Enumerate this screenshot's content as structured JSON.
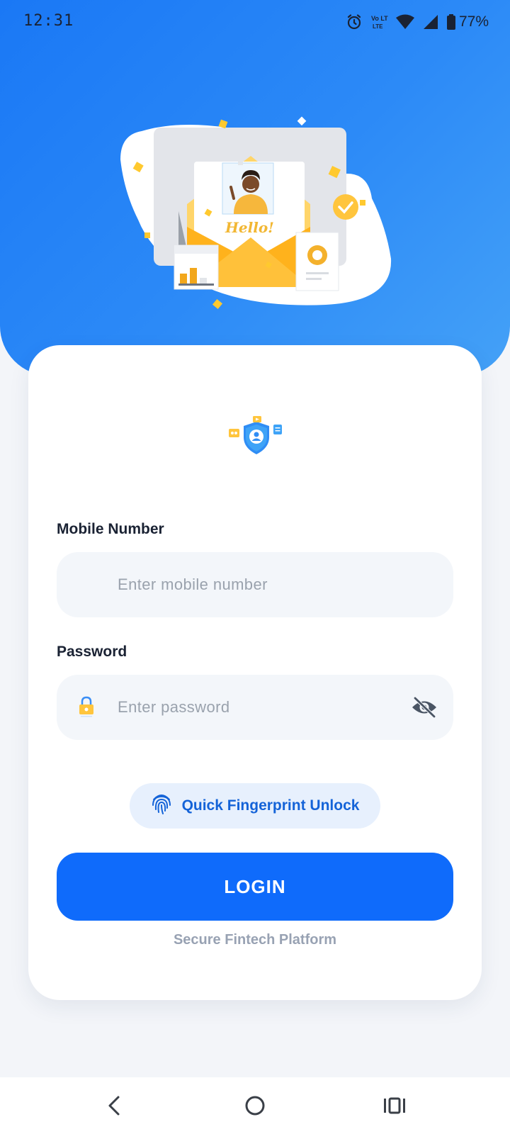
{
  "status_bar": {
    "time": "12:31",
    "volte_label": "Vo LTE",
    "battery": "77%",
    "icons": [
      "alarm-icon",
      "volte-icon",
      "wifi-icon",
      "signal-icon",
      "battery-icon"
    ]
  },
  "hero_illustration": {
    "text": "Hello!"
  },
  "form": {
    "mobile_label": "Mobile Number",
    "mobile_placeholder": "Enter mobile number",
    "password_label": "Password",
    "password_placeholder": "Enter password",
    "fingerprint_label": "Quick Fingerprint Unlock",
    "login_label": "LOGIN",
    "footer": "Secure Fintech Platform"
  },
  "nav_bar": {
    "icons": [
      "back-icon",
      "home-icon",
      "recents-icon"
    ]
  },
  "colors": {
    "hero_gradient_start": "#1a78f5",
    "hero_gradient_end": "#44a1f7",
    "primary": "#0f6bfb",
    "fingerprint_bg": "#e7f0fd",
    "fingerprint_text": "#1463d8",
    "field_bg": "#f3f6fa",
    "page_bg": "#f3f5f9"
  }
}
